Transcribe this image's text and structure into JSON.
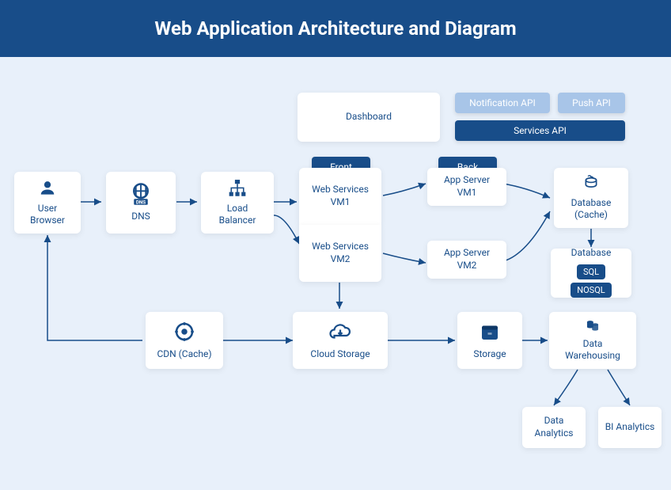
{
  "header": {
    "title": "Web Application Architecture and Diagram"
  },
  "dashboard": {
    "label": "Dashboard"
  },
  "apis": {
    "notification": "Notification API",
    "push": "Push API",
    "services": "Services API"
  },
  "tags": {
    "frontend": "Front End",
    "backend": "Back End"
  },
  "nodes": {
    "userBrowser": "User Browser",
    "dns": "DNS",
    "loadBalancer": "Load Balancer",
    "webServices1": "Web Services VM1",
    "webServices2": "Web Services VM2",
    "appServer1": "App Server VM1",
    "appServer2": "App Server VM2",
    "databaseCache": "Database (Cache)",
    "database": "Database",
    "sql": "SQL",
    "nosql": "NOSQL",
    "cdn": "CDN (Cache)",
    "cloudStorage": "Cloud Storage",
    "storage": "Storage",
    "dataWarehousing": "Data Warehousing",
    "dataAnalytics": "Data Analytics",
    "biAnalytics": "BI Analytics"
  }
}
